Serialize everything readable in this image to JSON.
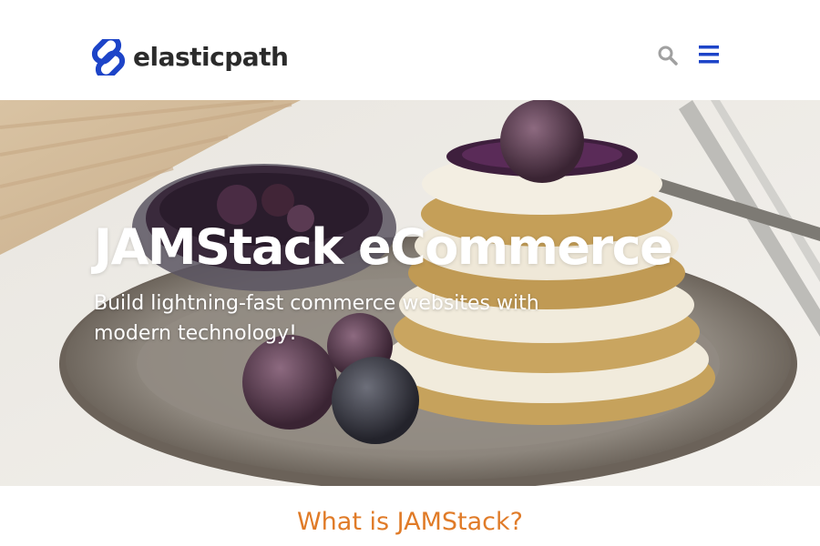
{
  "brand": {
    "name": "elasticpath",
    "mark_icon": "elasticpath-logo-mark",
    "mark_color": "#1d44c8"
  },
  "header": {
    "search_icon": "search-icon",
    "menu_icon": "hamburger-menu-icon",
    "search_color": "#a0a0a0",
    "menu_color": "#1d44c8"
  },
  "hero": {
    "image": "dessert-plate-photo",
    "title": "JAMStack eCommerce",
    "subtitle": "Build lightning-fast commerce websites with modern technology!"
  },
  "section": {
    "title": "What is JAMStack?",
    "title_color": "#e07b28"
  }
}
